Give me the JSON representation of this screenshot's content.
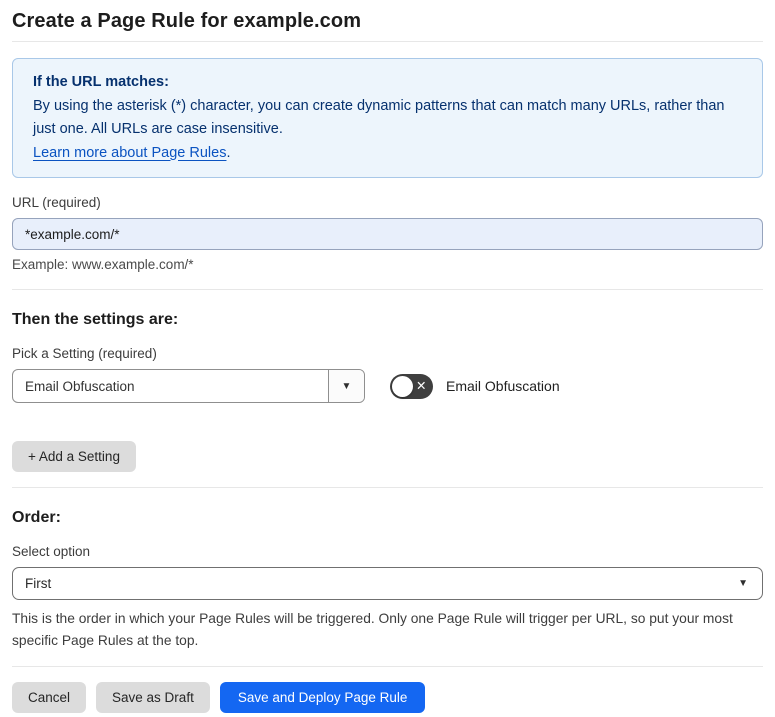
{
  "page": {
    "title": "Create a Page Rule for example.com"
  },
  "info_box": {
    "heading": "If the URL matches:",
    "body": "By using the asterisk (*) character, you can create dynamic patterns that can match many URLs, rather than just one. All URLs are case insensitive.",
    "link_text": "Learn more about Page Rules",
    "link_suffix": "."
  },
  "url_field": {
    "label": "URL (required)",
    "value": "*example.com/*",
    "helper": "Example: www.example.com/*"
  },
  "settings_section": {
    "heading": "Then the settings are:",
    "picker_label": "Pick a Setting (required)",
    "picker_value": "Email Obfuscation",
    "toggle_label": "Email Obfuscation",
    "toggle_state": "off",
    "add_button_label": "+ Add a Setting"
  },
  "order_section": {
    "heading": "Order:",
    "select_label": "Select option",
    "select_value": "First",
    "helper": "This is the order in which your Page Rules will be triggered. Only one Page Rule will trigger per URL, so put your most specific Page Rules at the top."
  },
  "footer": {
    "cancel_label": "Cancel",
    "save_draft_label": "Save as Draft",
    "save_deploy_label": "Save and Deploy Page Rule"
  },
  "icons": {
    "dropdown_caret": "▼",
    "toggle_off_x": "✕"
  },
  "colors": {
    "info_box_bg": "#edf5fc",
    "info_box_border": "#a9c8e8",
    "info_box_text": "#06316e",
    "link_blue": "#0b53c1",
    "url_input_bg": "#e8effb",
    "toggle_off_bg": "#3f3f3f",
    "gray_button_bg": "#dcdcdc",
    "primary_button_bg": "#1467f2",
    "primary_button_text": "#ffffff"
  }
}
